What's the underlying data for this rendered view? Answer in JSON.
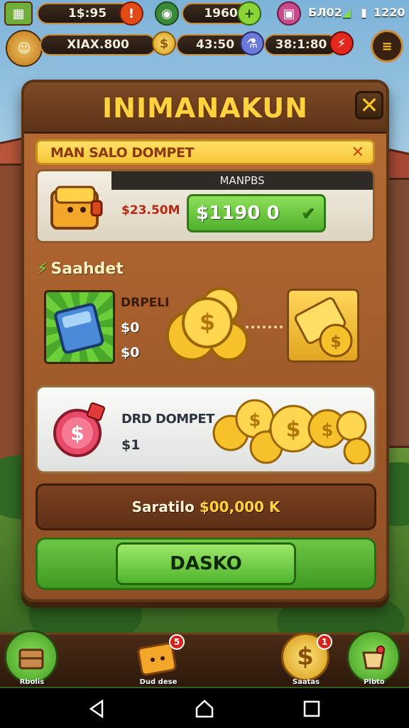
{
  "hud": {
    "timer": "1$:95",
    "gems": "1960",
    "status": "БЛ02",
    "clock": "1220",
    "player": "XIAX.800",
    "coins": "43:50",
    "energy": "38:1:80"
  },
  "dialog": {
    "title": "INIMANAKUN",
    "banner": "MAN SALO DOMPET",
    "wallet_header": "MANPBS",
    "wallet_price": "$23.50M",
    "wallet_button": "$1190 0",
    "section_label": "Saahdet",
    "item_name": "DRPELI",
    "item_value_1": "$0",
    "item_value_2": "$0",
    "offer_name": "DRD DOMPET",
    "offer_value": "$1",
    "total_label": "Saratilo",
    "total_amount": "$00,000 K",
    "action_button": "DASKO"
  },
  "dock": {
    "items": [
      {
        "label": "Rbolis"
      },
      {
        "label": "Dud dese",
        "badge": "5"
      },
      {
        "label": "Saatas",
        "badge": "1"
      },
      {
        "label": "Plbto"
      }
    ]
  },
  "colors": {
    "title_gold": "#ffd23f",
    "panel_brown": "#a45d2c",
    "action_green": "#4fb52c"
  }
}
